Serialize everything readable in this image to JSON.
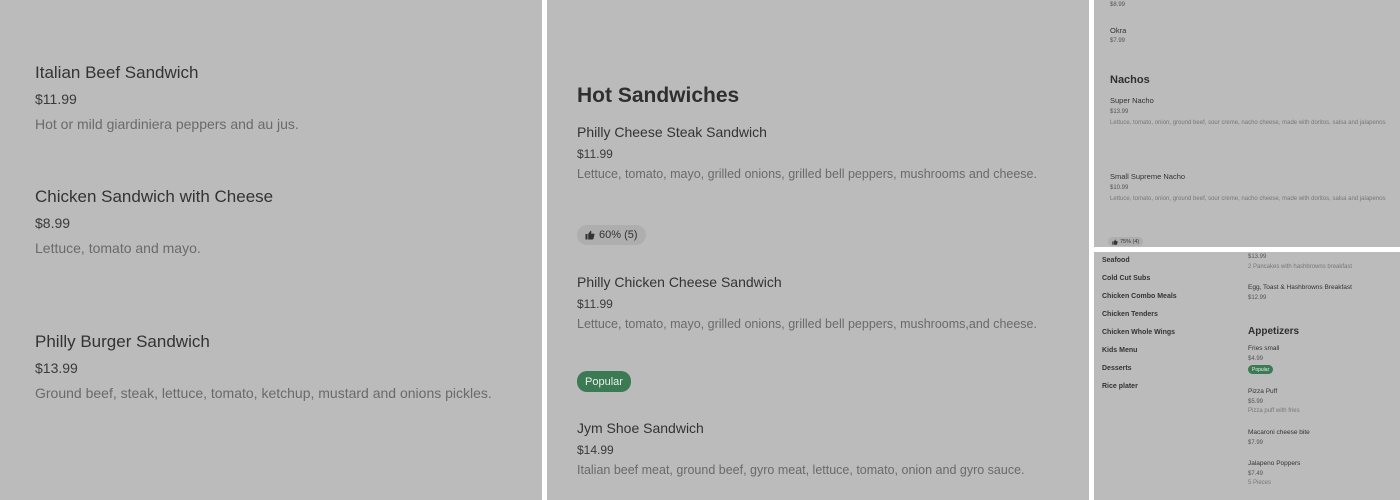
{
  "panel1": {
    "items": [
      {
        "name": "Italian Beef Sandwich",
        "price": "$11.99",
        "desc": "Hot or mild giardiniera peppers and au jus."
      },
      {
        "name": "Chicken Sandwich with Cheese",
        "price": "$8.99",
        "desc": "Lettuce, tomato and mayo."
      },
      {
        "name": "Philly Burger Sandwich",
        "price": "$13.99",
        "desc": "Ground beef, steak, lettuce, tomato, ketchup, mustard and onions pickles."
      }
    ]
  },
  "panel2": {
    "section_title": "Hot Sandwiches",
    "items": [
      {
        "name": "Philly Cheese Steak Sandwich",
        "price": "$11.99",
        "desc": "Lettuce, tomato, mayo, grilled onions, grilled bell peppers, mushrooms and cheese.",
        "rating": "60% (5)"
      },
      {
        "name": "Philly Chicken Cheese Sandwich",
        "price": "$11.99",
        "desc": "Lettuce, tomato, mayo, grilled onions, grilled bell peppers, mushrooms,and cheese.",
        "badge": "Popular"
      },
      {
        "name": "Jym Shoe Sandwich",
        "price": "$14.99",
        "desc": "Italian beef meat, ground beef, gyro meat, lettuce, tomato, onion and gyro sauce."
      }
    ]
  },
  "panel3": {
    "top_price": "$8.99",
    "okra": {
      "name": "Okra",
      "price": "$7.99"
    },
    "section_title": "Nachos",
    "items": [
      {
        "name": "Super Nacho",
        "price": "$13.99",
        "desc": "Lettuce, tomato, onion, ground beef, sour creme, nacho cheese, made with doritos, salsa and jalapenos"
      },
      {
        "name": "Small Supreme Nacho",
        "price": "$10.99",
        "desc": "Lettuce, tomato, onion, ground beef, sour creme, nacho cheese, made with doritos, salsa and jalapenos",
        "rating": "75% (4)"
      }
    ]
  },
  "panel4": {
    "categories": [
      "Seafood",
      "Cold Cut Subs",
      "Chicken Combo Meals",
      "Chicken Tenders",
      "Chicken Whole Wings",
      "Kids Menu",
      "Desserts",
      "Rice plater"
    ],
    "top_price": "$13.99",
    "top_desc": "2 Pancakes with hashbrowns breakfast",
    "egg": {
      "name": "Egg, Toast & Hashbrowns Breakfast",
      "price": "$12.99"
    },
    "section_title": "Appetizers",
    "items": [
      {
        "name": "Fries small",
        "price": "$4.99",
        "badge": "Popular"
      },
      {
        "name": "Pizza Puff",
        "price": "$5.99",
        "desc": "Pizza puff with fries"
      },
      {
        "name": "Macaroni cheese bite",
        "price": "$7.99"
      },
      {
        "name": "Jalapeno Poppers",
        "price": "$7.49",
        "desc": "5 Pieces"
      }
    ]
  }
}
